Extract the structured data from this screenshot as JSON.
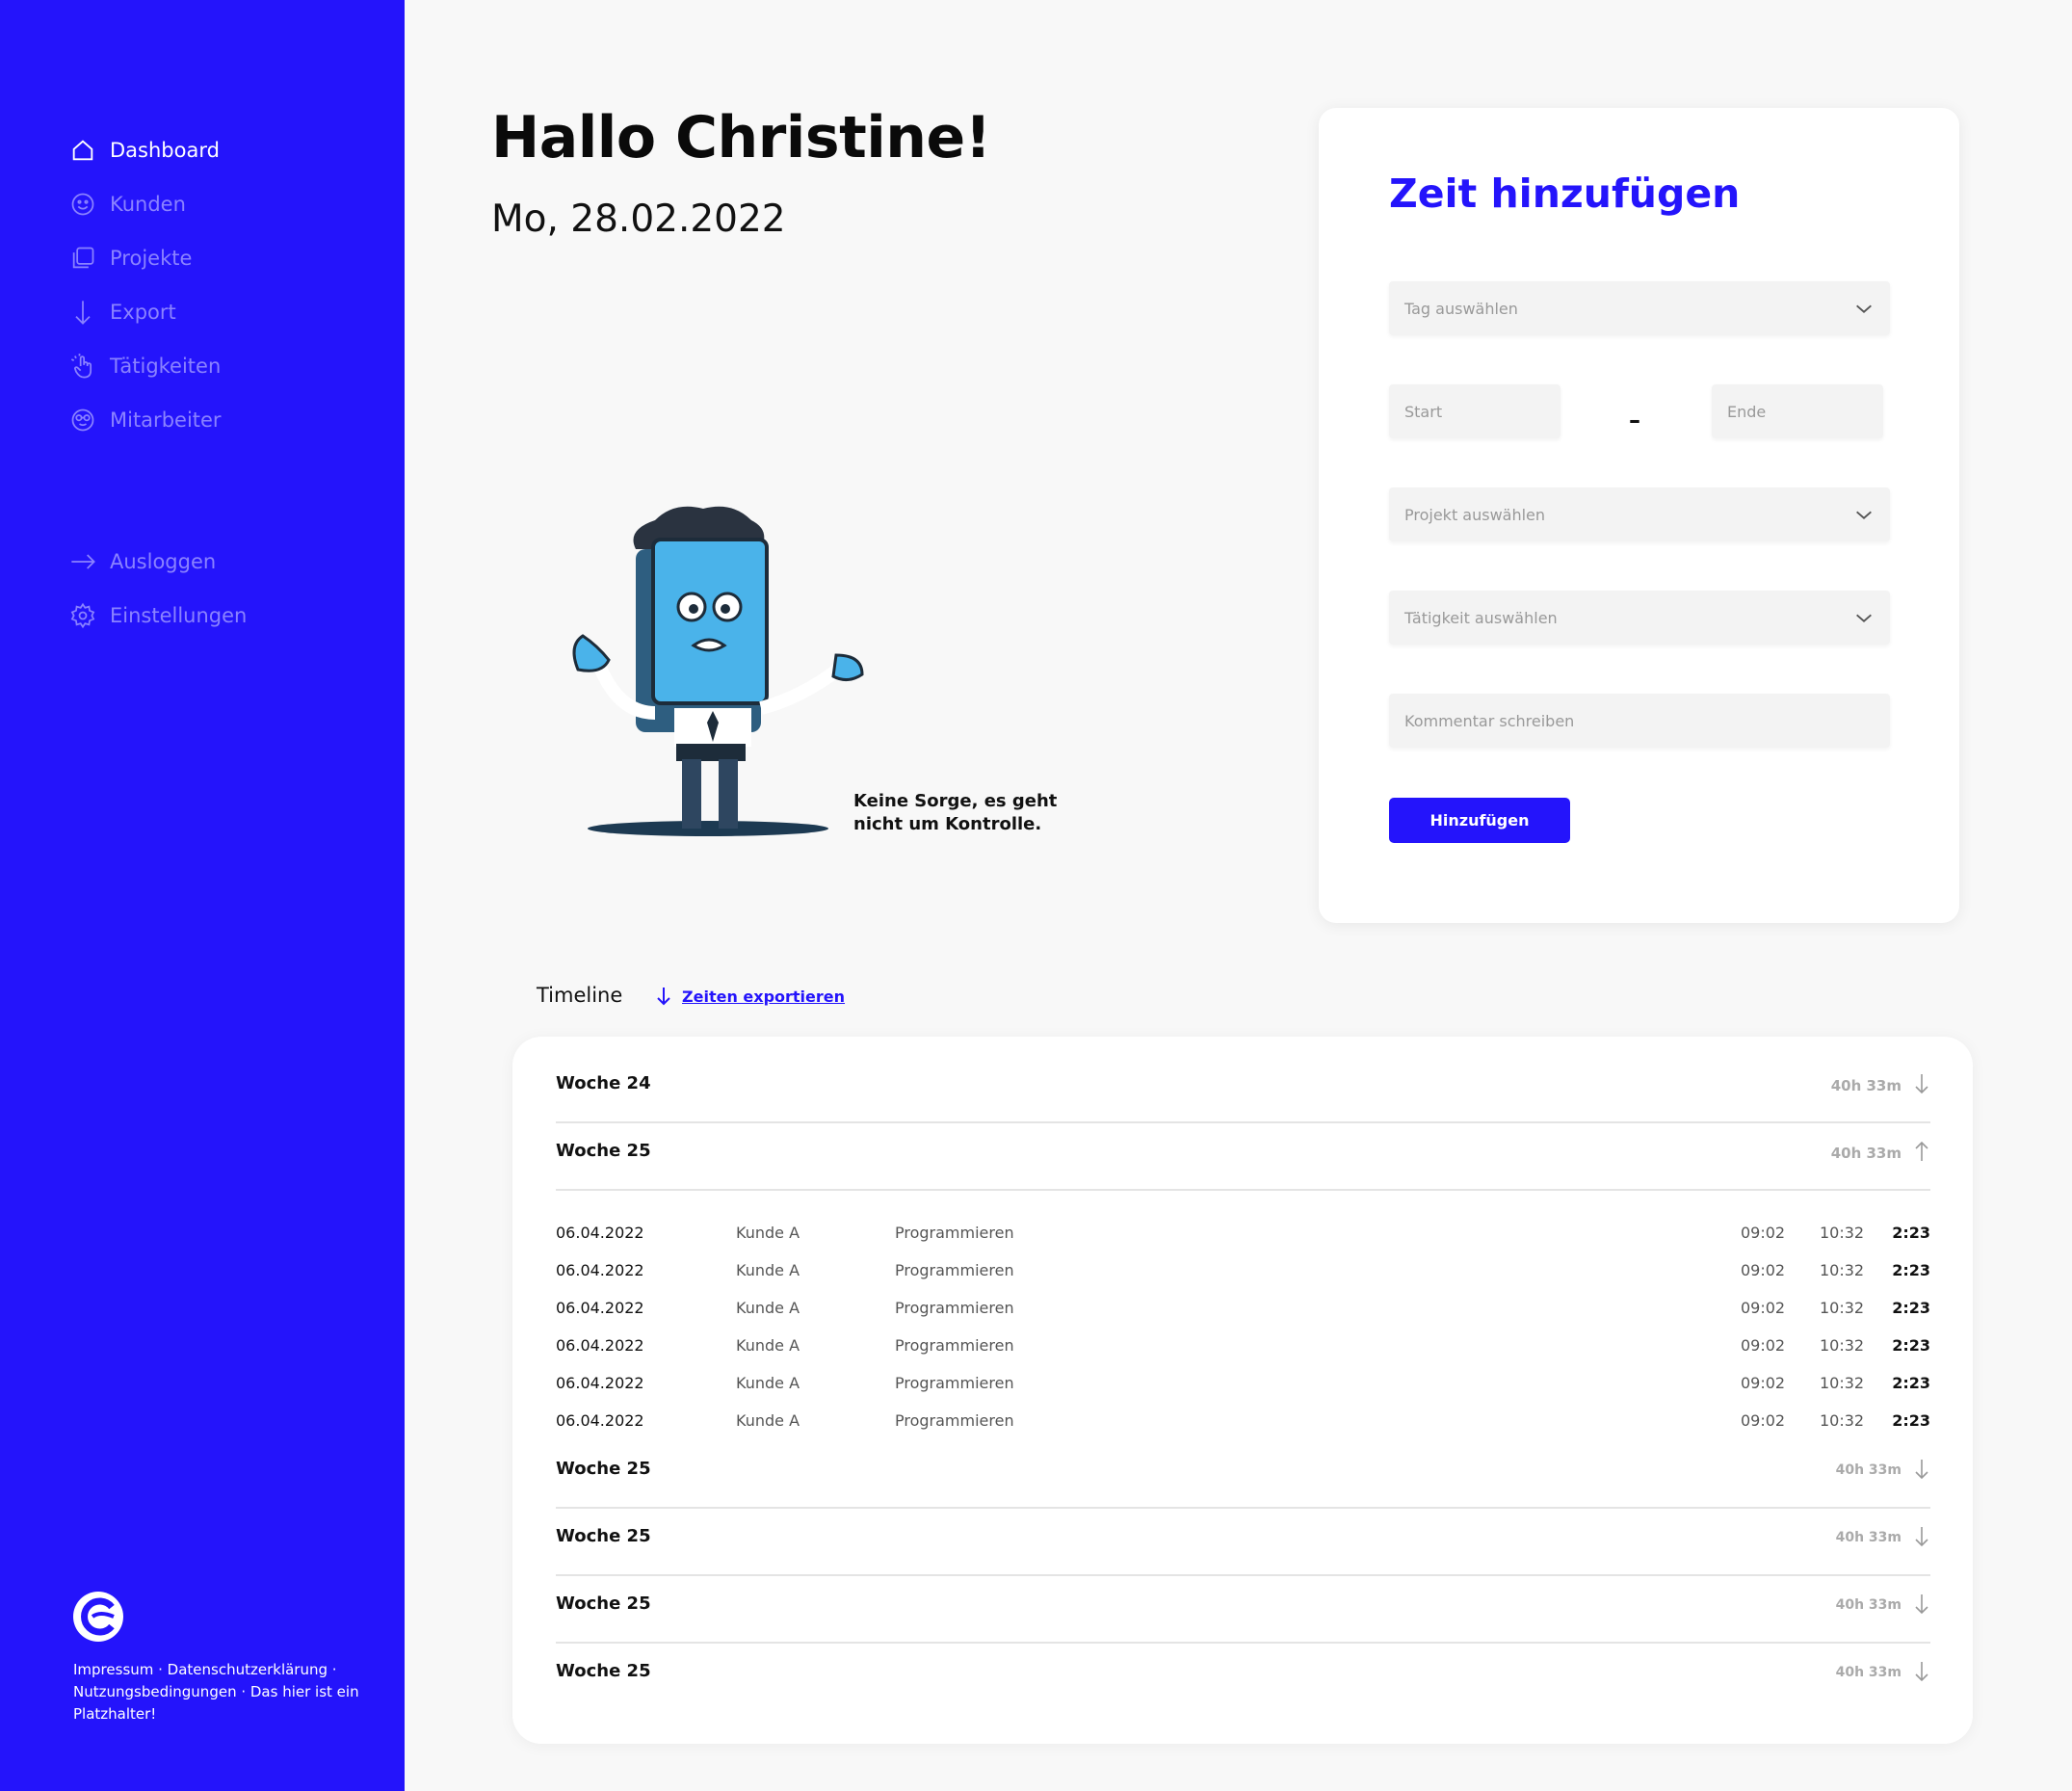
{
  "sidebar": {
    "nav": [
      {
        "label": "Dashboard",
        "icon": "home-icon",
        "active": true
      },
      {
        "label": "Kunden",
        "icon": "smiley-icon"
      },
      {
        "label": "Projekte",
        "icon": "copy-icon"
      },
      {
        "label": "Export",
        "icon": "arrow-down-icon"
      },
      {
        "label": "Tätigkeiten",
        "icon": "hand-pointer-icon"
      },
      {
        "label": "Mitarbeiter",
        "icon": "glasses-face-icon"
      }
    ],
    "secondary": [
      {
        "label": "Ausloggen",
        "icon": "arrow-right-icon"
      },
      {
        "label": "Einstellungen",
        "icon": "gear-icon"
      }
    ],
    "footer": "Impressum · Datenschutzerklärung · Nutzungsbedingungen · Das hier ist ein Platzhalter!",
    "colors": {
      "background": "#2414fb",
      "active": "#ffffff",
      "inactive": "#8a82ff"
    }
  },
  "header": {
    "greeting": "Hallo Christine!",
    "date": "Mo, 28.02.2022"
  },
  "mascot": {
    "caption_line1": "Keine Sorge, es geht",
    "caption_line2": "nicht um Kontrolle."
  },
  "form": {
    "title": "Zeit hinzufügen",
    "day_placeholder": "Tag auswählen",
    "start_placeholder": "Start",
    "separator": "–",
    "end_placeholder": "Ende",
    "project_placeholder": "Projekt auswählen",
    "activity_placeholder": "Tätigkeit auswählen",
    "comment_placeholder": "Kommentar schreiben",
    "submit_label": "Hinzufügen"
  },
  "timeline": {
    "title": "Timeline",
    "export_label": "Zeiten exportieren",
    "weeks": [
      {
        "label": "Woche 24",
        "total": "40h 33m",
        "expanded": false
      },
      {
        "label": "Woche 25",
        "total": "40h 33m",
        "expanded": true
      },
      {
        "label": "Woche 25",
        "total": "40h 33m",
        "expanded": false
      },
      {
        "label": "Woche 25",
        "total": "40h 33m",
        "expanded": false
      },
      {
        "label": "Woche 25",
        "total": "40h 33m",
        "expanded": false
      },
      {
        "label": "Woche 25",
        "total": "40h 33m",
        "expanded": false
      }
    ],
    "entries": [
      {
        "date": "06.04.2022",
        "client": "Kunde A",
        "activity": "Programmieren",
        "start": "09:02",
        "end": "10:32",
        "duration": "2:23"
      },
      {
        "date": "06.04.2022",
        "client": "Kunde A",
        "activity": "Programmieren",
        "start": "09:02",
        "end": "10:32",
        "duration": "2:23"
      },
      {
        "date": "06.04.2022",
        "client": "Kunde A",
        "activity": "Programmieren",
        "start": "09:02",
        "end": "10:32",
        "duration": "2:23"
      },
      {
        "date": "06.04.2022",
        "client": "Kunde A",
        "activity": "Programmieren",
        "start": "09:02",
        "end": "10:32",
        "duration": "2:23"
      },
      {
        "date": "06.04.2022",
        "client": "Kunde A",
        "activity": "Programmieren",
        "start": "09:02",
        "end": "10:32",
        "duration": "2:23"
      },
      {
        "date": "06.04.2022",
        "client": "Kunde A",
        "activity": "Programmieren",
        "start": "09:02",
        "end": "10:32",
        "duration": "2:23"
      }
    ]
  }
}
